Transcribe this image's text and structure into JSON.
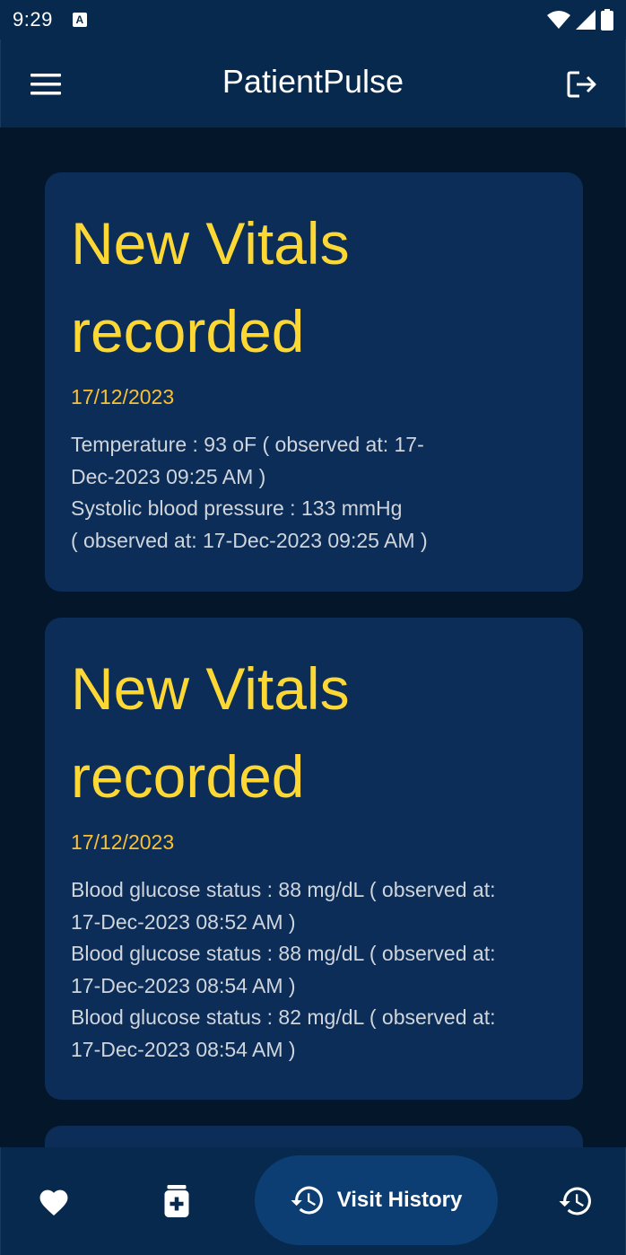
{
  "status_bar": {
    "time": "9:29",
    "notif_letter": "A"
  },
  "app_bar": {
    "title": "PatientPulse"
  },
  "cards": [
    {
      "title_line1": "New Vitals",
      "title_line2": "recorded",
      "date": "17/12/2023",
      "lines": [
        "Temperature : 93 oF ( observed at: 17-",
        "Dec-2023 09:25 AM )",
        "Systolic blood pressure : 133 mmHg",
        "( observed at: 17-Dec-2023 09:25 AM )"
      ]
    },
    {
      "title_line1": "New Vitals",
      "title_line2": "recorded",
      "date": "17/12/2023",
      "lines": [
        "Blood glucose status : 88 mg/dL ( observed at:",
        "17-Dec-2023 08:52 AM )",
        "Blood glucose status : 88 mg/dL ( observed at:",
        "17-Dec-2023 08:54 AM )",
        "Blood glucose status : 82 mg/dL ( observed at:",
        "17-Dec-2023 08:54 AM )"
      ]
    }
  ],
  "bottom_nav": {
    "items": [
      {
        "icon": "heart-icon"
      },
      {
        "icon": "medicine-icon"
      },
      {
        "icon": "history-icon",
        "label": "Visit History",
        "active": true
      },
      {
        "icon": "history-icon"
      }
    ]
  },
  "colors": {
    "background": "#04172a",
    "app_bar": "#07294d",
    "card": "#0b2d57",
    "title_yellow": "#fdd835",
    "date_yellow": "#fbc02d",
    "active_pill": "#0d3e73"
  }
}
